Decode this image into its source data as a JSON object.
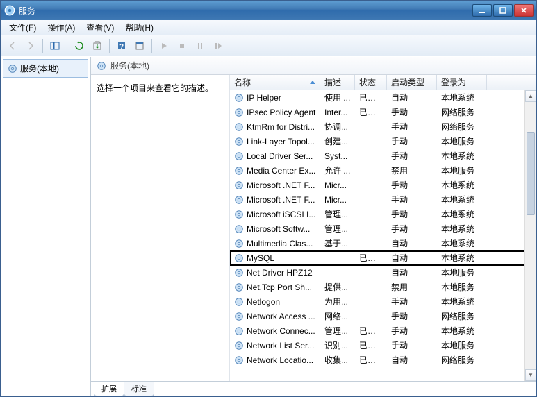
{
  "window": {
    "title": "服务"
  },
  "menu": {
    "file": "文件(F)",
    "action": "操作(A)",
    "view": "查看(V)",
    "help": "帮助(H)"
  },
  "left_pane": {
    "item_label": "服务(本地)"
  },
  "right_header": "服务(本地)",
  "desc_hint": "选择一个项目来查看它的描述。",
  "columns": {
    "name": "名称",
    "desc": "描述",
    "status": "状态",
    "startup": "启动类型",
    "logon": "登录为"
  },
  "services": [
    {
      "name": "IP Helper",
      "desc": "使用 ...",
      "status": "已启动",
      "startup": "自动",
      "logon": "本地系统",
      "hl": false
    },
    {
      "name": "IPsec Policy Agent",
      "desc": "Inter...",
      "status": "已启动",
      "startup": "手动",
      "logon": "网络服务",
      "hl": false
    },
    {
      "name": "KtmRm for Distri...",
      "desc": "协调...",
      "status": "",
      "startup": "手动",
      "logon": "网络服务",
      "hl": false
    },
    {
      "name": "Link-Layer Topol...",
      "desc": "创建...",
      "status": "",
      "startup": "手动",
      "logon": "本地服务",
      "hl": false
    },
    {
      "name": "Local Driver Ser...",
      "desc": "Syst...",
      "status": "",
      "startup": "手动",
      "logon": "本地系统",
      "hl": false
    },
    {
      "name": "Media Center Ex...",
      "desc": "允许 ...",
      "status": "",
      "startup": "禁用",
      "logon": "本地服务",
      "hl": false
    },
    {
      "name": "Microsoft .NET F...",
      "desc": "Micr...",
      "status": "",
      "startup": "手动",
      "logon": "本地系统",
      "hl": false
    },
    {
      "name": "Microsoft .NET F...",
      "desc": "Micr...",
      "status": "",
      "startup": "手动",
      "logon": "本地系统",
      "hl": false
    },
    {
      "name": "Microsoft iSCSI I...",
      "desc": "管理...",
      "status": "",
      "startup": "手动",
      "logon": "本地系统",
      "hl": false
    },
    {
      "name": "Microsoft Softw...",
      "desc": "管理...",
      "status": "",
      "startup": "手动",
      "logon": "本地系统",
      "hl": false
    },
    {
      "name": "Multimedia Clas...",
      "desc": "基于...",
      "status": "",
      "startup": "自动",
      "logon": "本地系统",
      "hl": false
    },
    {
      "name": "MySQL",
      "desc": "",
      "status": "已启动",
      "startup": "自动",
      "logon": "本地系统",
      "hl": true
    },
    {
      "name": "Net Driver HPZ12",
      "desc": "",
      "status": "",
      "startup": "自动",
      "logon": "本地服务",
      "hl": false
    },
    {
      "name": "Net.Tcp Port Sh...",
      "desc": "提供...",
      "status": "",
      "startup": "禁用",
      "logon": "本地服务",
      "hl": false
    },
    {
      "name": "Netlogon",
      "desc": "为用...",
      "status": "",
      "startup": "手动",
      "logon": "本地系统",
      "hl": false
    },
    {
      "name": "Network Access ...",
      "desc": "网络...",
      "status": "",
      "startup": "手动",
      "logon": "网络服务",
      "hl": false
    },
    {
      "name": "Network Connec...",
      "desc": "管理...",
      "status": "已启动",
      "startup": "手动",
      "logon": "本地系统",
      "hl": false
    },
    {
      "name": "Network List Ser...",
      "desc": "识别...",
      "status": "已启动",
      "startup": "手动",
      "logon": "本地服务",
      "hl": false
    },
    {
      "name": "Network Locatio...",
      "desc": "收集...",
      "status": "已启动",
      "startup": "自动",
      "logon": "网络服务",
      "hl": false
    }
  ],
  "tabs": {
    "extended": "扩展",
    "standard": "标准"
  }
}
